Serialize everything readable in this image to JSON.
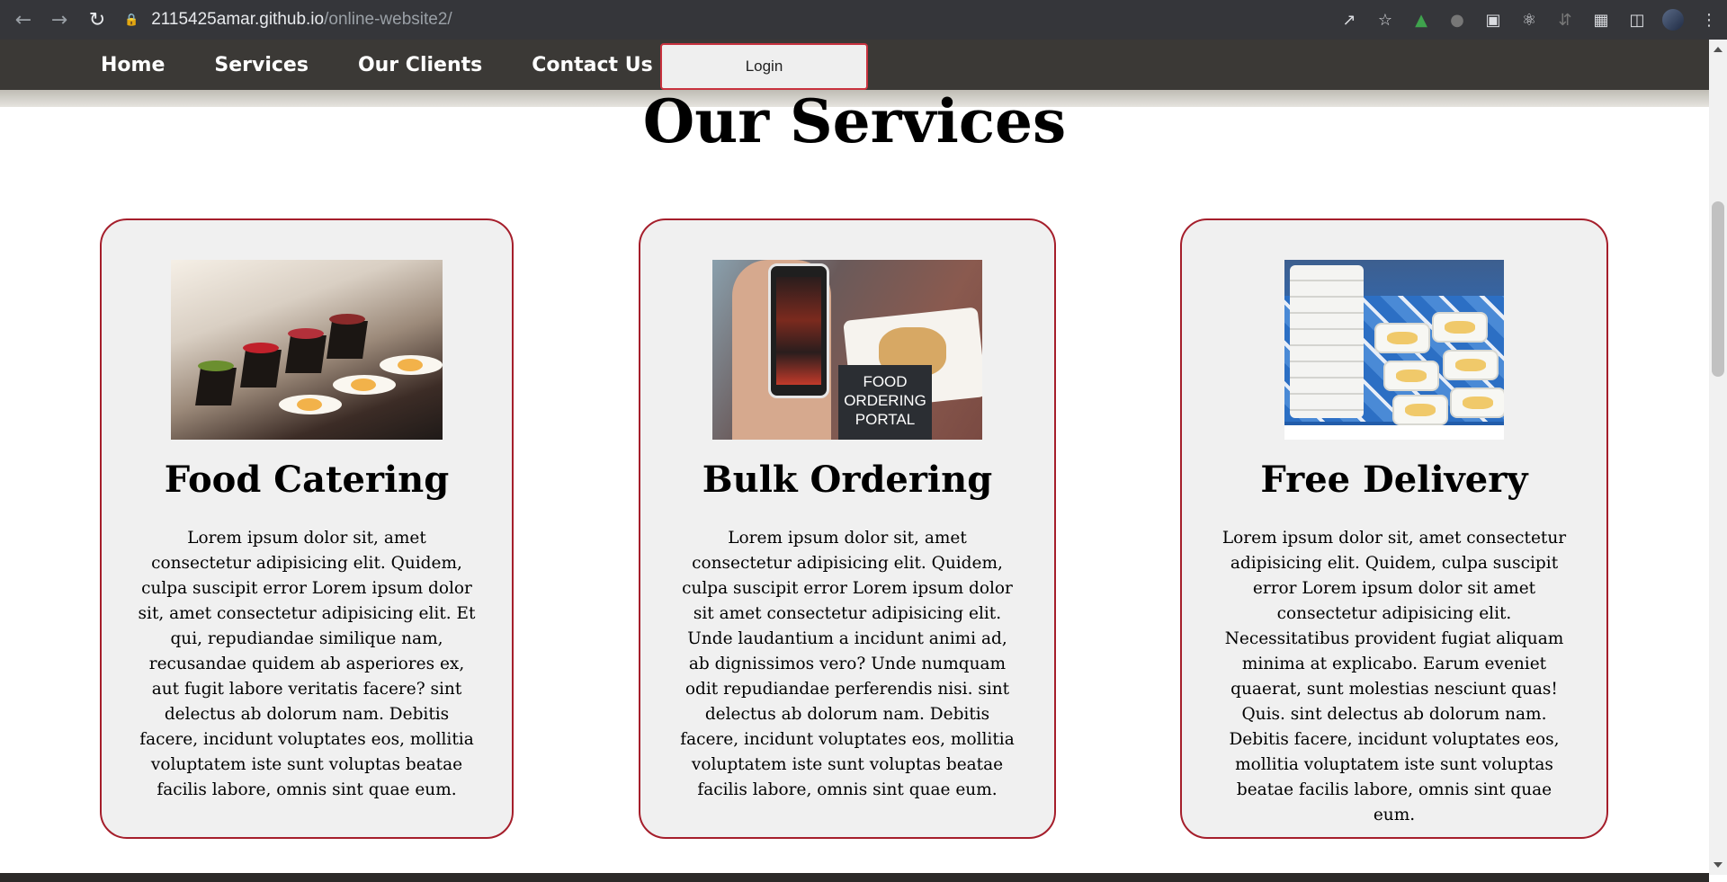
{
  "browser": {
    "url_host": "2115425amar.github.io",
    "url_path": "/online-website2/",
    "icons": [
      "back-icon",
      "forward-icon",
      "reload-icon",
      "lock-icon",
      "share-icon",
      "star-icon",
      "extension-tree-icon",
      "extension-icon",
      "picture-in-picture-icon",
      "react-devtools-icon",
      "extension-icon",
      "puzzle-icon",
      "side-panel-icon",
      "profile-avatar",
      "menu-icon"
    ]
  },
  "nav": {
    "links": [
      "Home",
      "Services",
      "Our Clients",
      "Contact Us"
    ],
    "login_label": "Login"
  },
  "page": {
    "title": "Our Services"
  },
  "services": [
    {
      "title": "Food Catering",
      "body": "Lorem ipsum dolor sit, amet consectetur adipisicing elit. Quidem, culpa suscipit error Lorem ipsum dolor sit, amet consectetur adipisicing elit. Et qui, repudiandae similique nam, recusandae quidem ab asperiores ex, aut fugit labore veritatis facere? sint delectus ab dolorum nam. Debitis facere, incidunt voluptates eos, mollitia voluptatem iste sunt voluptas beatae facilis labore, omnis sint quae eum."
    },
    {
      "title": "Bulk Ordering",
      "image_caption": "FOOD ORDERING PORTAL",
      "body": "Lorem ipsum dolor sit, amet consectetur adipisicing elit. Quidem, culpa suscipit error Lorem ipsum dolor sit amet consectetur adipisicing elit. Unde laudantium a incidunt animi ad, ab dignissimos vero? Unde numquam odit repudiandae perferendis nisi. sint delectus ab dolorum nam. Debitis facere, incidunt voluptates eos, mollitia voluptatem iste sunt voluptas beatae facilis labore, omnis sint quae eum."
    },
    {
      "title": "Free Delivery",
      "body": "Lorem ipsum dolor sit, amet consectetur adipisicing elit. Quidem, culpa suscipit error Lorem ipsum dolor sit amet consectetur adipisicing elit. Necessitatibus provident fugiat aliquam minima at explicabo. Earum eveniet quaerat, sunt molestias nesciunt quas! Quis. sint delectus ab dolorum nam. Debitis facere, incidunt voluptates eos, mollitia voluptatem iste sunt voluptas beatae facilis labore, omnis sint quae eum."
    }
  ],
  "colors": {
    "card_border": "#a51e2b",
    "card_bg": "#f0f0f0",
    "nav_bg": "#3b3936",
    "login_border": "#c8323e"
  }
}
